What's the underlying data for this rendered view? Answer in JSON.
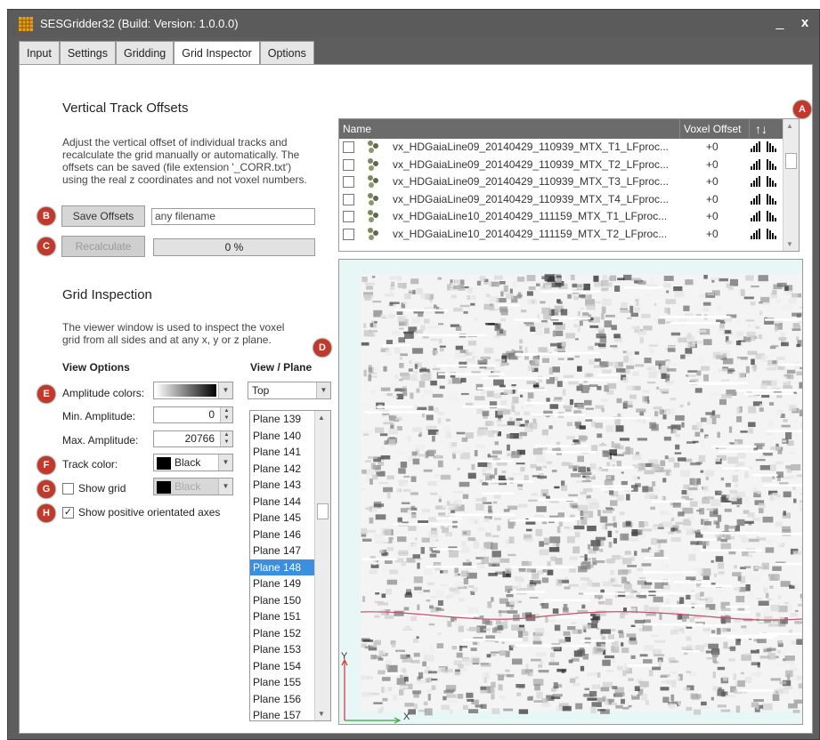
{
  "window": {
    "title": "SESGridder32 (Build: Version: 1.0.0.0)",
    "minimize_glyph": "_",
    "close_glyph": "x"
  },
  "tabs": [
    "Input",
    "Settings",
    "Gridding",
    "Grid Inspector",
    "Options"
  ],
  "active_tab": "Grid Inspector",
  "markers": {
    "a": "A",
    "b": "B",
    "c": "C",
    "d": "D",
    "e": "E",
    "f": "F",
    "g": "G",
    "h": "H"
  },
  "offsets": {
    "heading": "Vertical Track Offsets",
    "desc_lines": [
      "Adjust the vertical offset of individual tracks and",
      "recalculate the grid manually or automatically. The",
      "offsets can be saved (file extension '_CORR.txt')",
      "using the real z coordinates and not voxel numbers."
    ],
    "save_button": "Save Offsets",
    "filename_value": "any filename",
    "recalc_button": "Recalculate",
    "progress": "0 %"
  },
  "inspection": {
    "heading": "Grid Inspection",
    "desc_lines": [
      "The viewer window is used to inspect the voxel",
      "grid from all sides and at any x, y or z plane."
    ]
  },
  "view_options": {
    "heading": "View Options",
    "amplitude_colors_label": "Amplitude colors:",
    "min_amplitude_label": "Min. Amplitude:",
    "min_amplitude_value": "0",
    "max_amplitude_label": "Max. Amplitude:",
    "max_amplitude_value": "20766",
    "track_color_label": "Track color:",
    "track_color_value": "Black",
    "show_grid_label": "Show grid",
    "grid_color_value": "Black",
    "show_axes_label": "Show positive orientated axes"
  },
  "view_plane": {
    "heading": "View / Plane",
    "view_value": "Top",
    "planes": [
      "Plane 139",
      "Plane 140",
      "Plane 141",
      "Plane 142",
      "Plane 143",
      "Plane 144",
      "Plane 145",
      "Plane 146",
      "Plane 147",
      "Plane 148",
      "Plane 149",
      "Plane 150",
      "Plane 151",
      "Plane 152",
      "Plane 153",
      "Plane 154",
      "Plane 155",
      "Plane 156",
      "Plane 157"
    ],
    "selected": "Plane 148"
  },
  "track_table": {
    "col_name": "Name",
    "col_offset": "Voxel Offset",
    "sort_glyph": "↑↓",
    "rows": [
      {
        "name": "vx_HDGaiaLine09_20140429_110939_MTX_T1_LFproc...",
        "offset": "+0"
      },
      {
        "name": "vx_HDGaiaLine09_20140429_110939_MTX_T2_LFproc...",
        "offset": "+0"
      },
      {
        "name": "vx_HDGaiaLine09_20140429_110939_MTX_T3_LFproc...",
        "offset": "+0"
      },
      {
        "name": "vx_HDGaiaLine09_20140429_110939_MTX_T4_LFproc...",
        "offset": "+0"
      },
      {
        "name": "vx_HDGaiaLine10_20140429_111159_MTX_T1_LFproc...",
        "offset": "+0"
      },
      {
        "name": "vx_HDGaiaLine10_20140429_111159_MTX_T2_LFproc...",
        "offset": "+0"
      }
    ]
  },
  "viewer": {
    "axis_x": "X",
    "axis_y": "Y",
    "track_color": "#c8506a"
  }
}
